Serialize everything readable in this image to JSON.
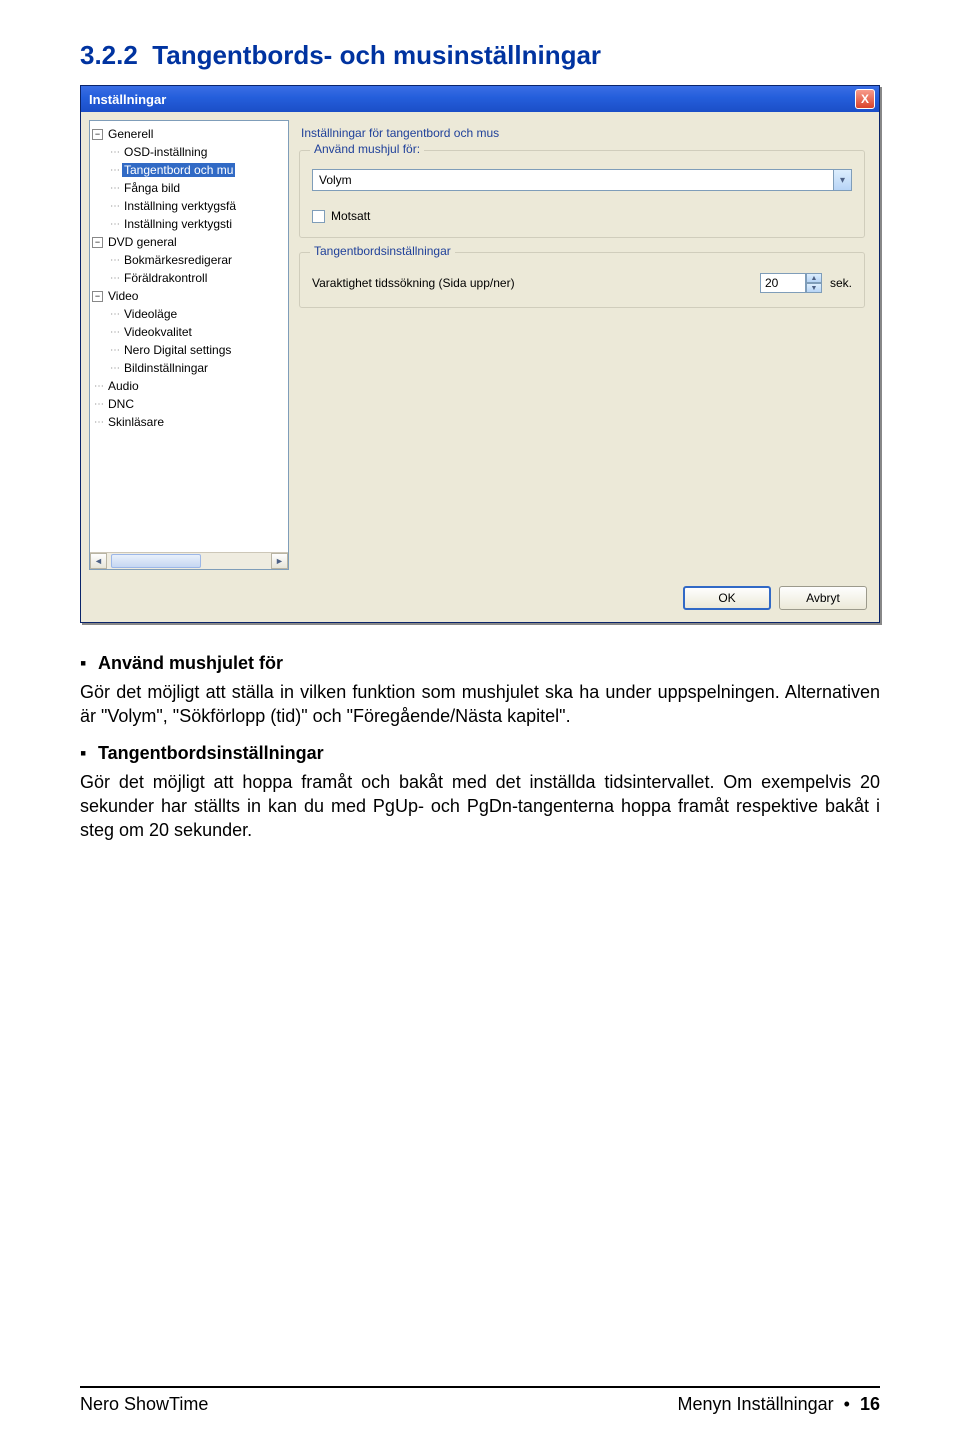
{
  "section": {
    "number": "3.2.2",
    "title": "Tangentbords- och musinställningar"
  },
  "dialog": {
    "title": "Inställningar",
    "close_icon": "X",
    "tree": {
      "items": [
        {
          "label": "Generell",
          "expandable": true,
          "expanded": true,
          "level": 0
        },
        {
          "label": "OSD-inställning",
          "level": 1
        },
        {
          "label": "Tangentbord och mu",
          "level": 1,
          "selected": true
        },
        {
          "label": "Fånga bild",
          "level": 1
        },
        {
          "label": "Inställning verktygsfä",
          "level": 1
        },
        {
          "label": "Inställning verktygsti",
          "level": 1
        },
        {
          "label": "DVD general",
          "expandable": true,
          "expanded": true,
          "level": 0
        },
        {
          "label": "Bokmärkesredigerar",
          "level": 1
        },
        {
          "label": "Föräldrakontroll",
          "level": 1
        },
        {
          "label": "Video",
          "expandable": true,
          "expanded": true,
          "level": 0
        },
        {
          "label": "Videoläge",
          "level": 1
        },
        {
          "label": "Videokvalitet",
          "level": 1
        },
        {
          "label": "Nero Digital settings",
          "level": 1
        },
        {
          "label": "Bildinställningar",
          "level": 1
        },
        {
          "label": "Audio",
          "level": 0
        },
        {
          "label": "DNC",
          "level": 0
        },
        {
          "label": "Skinläsare",
          "level": 0
        }
      ]
    },
    "panel_title": "Inställningar för tangentbord och mus",
    "group_mouse": {
      "title": "Använd mushjul för:",
      "selected_value": "Volym",
      "checkbox_label": "Motsatt"
    },
    "group_kbd": {
      "title": "Tangentbordsinställningar",
      "row_label": "Varaktighet tidssökning (Sida upp/ner)",
      "value": "20",
      "unit": "sek."
    },
    "buttons": {
      "ok": "OK",
      "cancel": "Avbryt"
    }
  },
  "body": {
    "bullet1_label": "Använd mushjulet för",
    "para1": "Gör det möjligt att ställa in vilken funktion som mushjulet ska ha under uppspelningen. Alternativen är \"Volym\", \"Sökförlopp (tid)\" och \"Föregående/Nästa kapitel\".",
    "bullet2_label": "Tangentbordsinställningar",
    "para2": "Gör det möjligt att hoppa framåt och bakåt med det inställda tidsintervallet. Om exempelvis 20 sekunder har ställts in kan du med PgUp- och PgDn-tangenterna hoppa framåt respektive bakåt i steg om 20 sekunder."
  },
  "footer": {
    "product": "Nero ShowTime",
    "menu": "Menyn Inställningar",
    "bullet": "•",
    "page_no": "16"
  }
}
